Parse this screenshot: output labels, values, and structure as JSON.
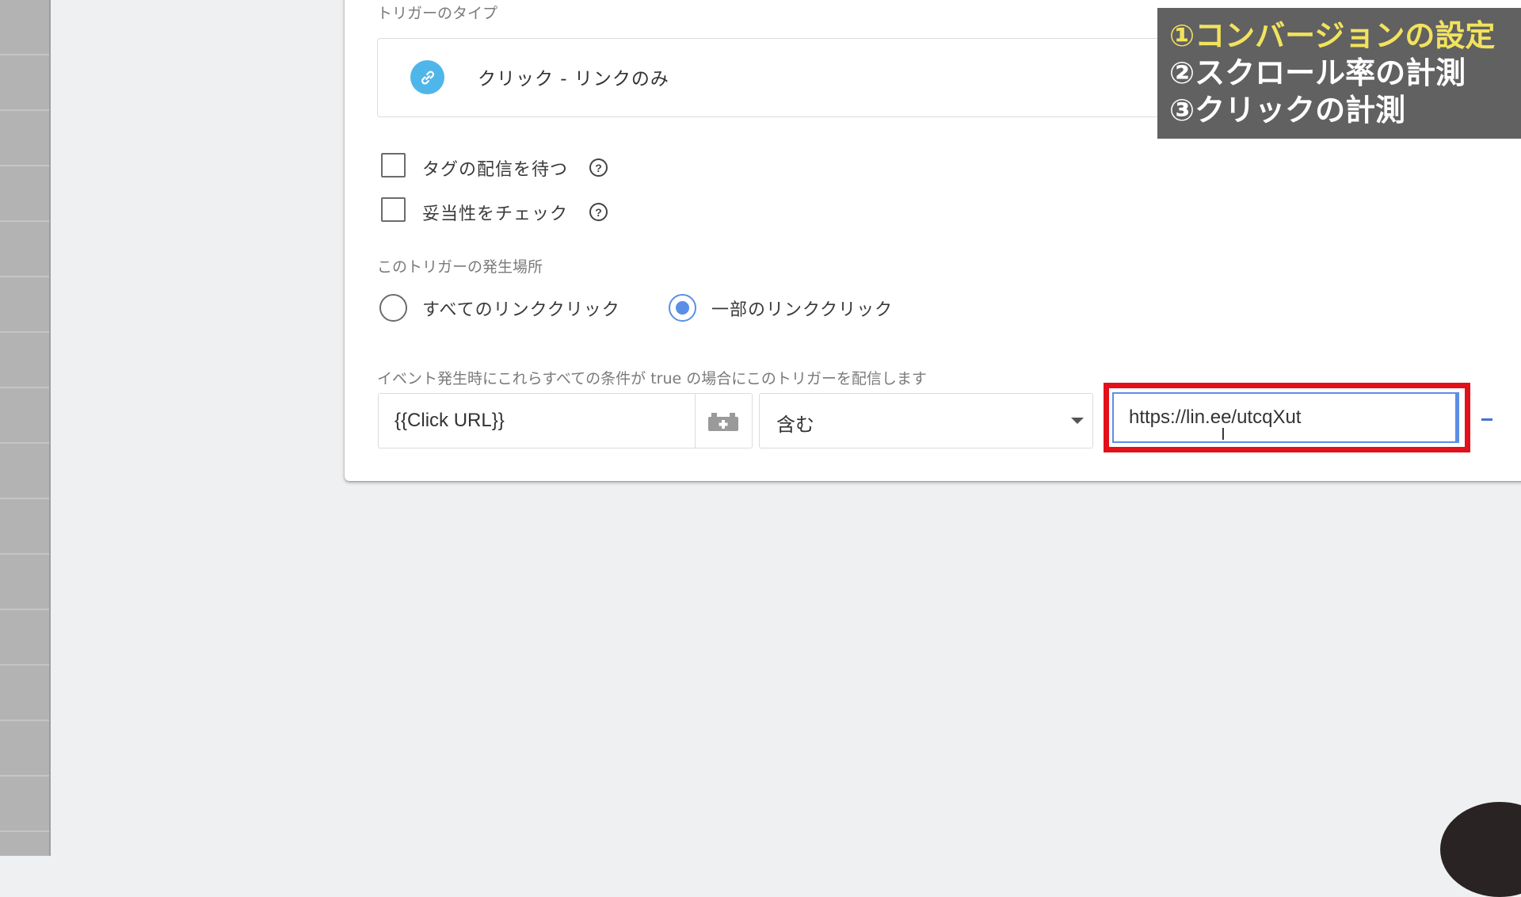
{
  "trigger_type": {
    "section_label": "トリガーのタイプ",
    "name": "クリック - リンクのみ",
    "icon": "link-icon",
    "icon_color": "#4fb6e9"
  },
  "options": {
    "wait_for_tags": {
      "label": "タグの配信を待つ",
      "checked": false
    },
    "check_validation": {
      "label": "妥当性をチェック",
      "checked": false
    }
  },
  "fires_on": {
    "section_label": "このトリガーの発生場所",
    "all_clicks_label": "すべてのリンククリック",
    "some_clicks_label": "一部のリンククリック",
    "selected": "some_clicks"
  },
  "condition": {
    "section_label": "イベント発生時にこれらすべての条件が true の場合にこのトリガーを配信します",
    "variable": "{{Click URL}}",
    "operator": "含む",
    "value": "https://lin.ee/utcqXut",
    "highlight_color": "#e1101b",
    "focus_color": "#5b8ee6"
  },
  "overlay": {
    "line1": "①コンバージョンの設定",
    "line2": "②スクロール率の計測",
    "line3": "③クリックの計測",
    "line1_color": "#f2e35d"
  }
}
